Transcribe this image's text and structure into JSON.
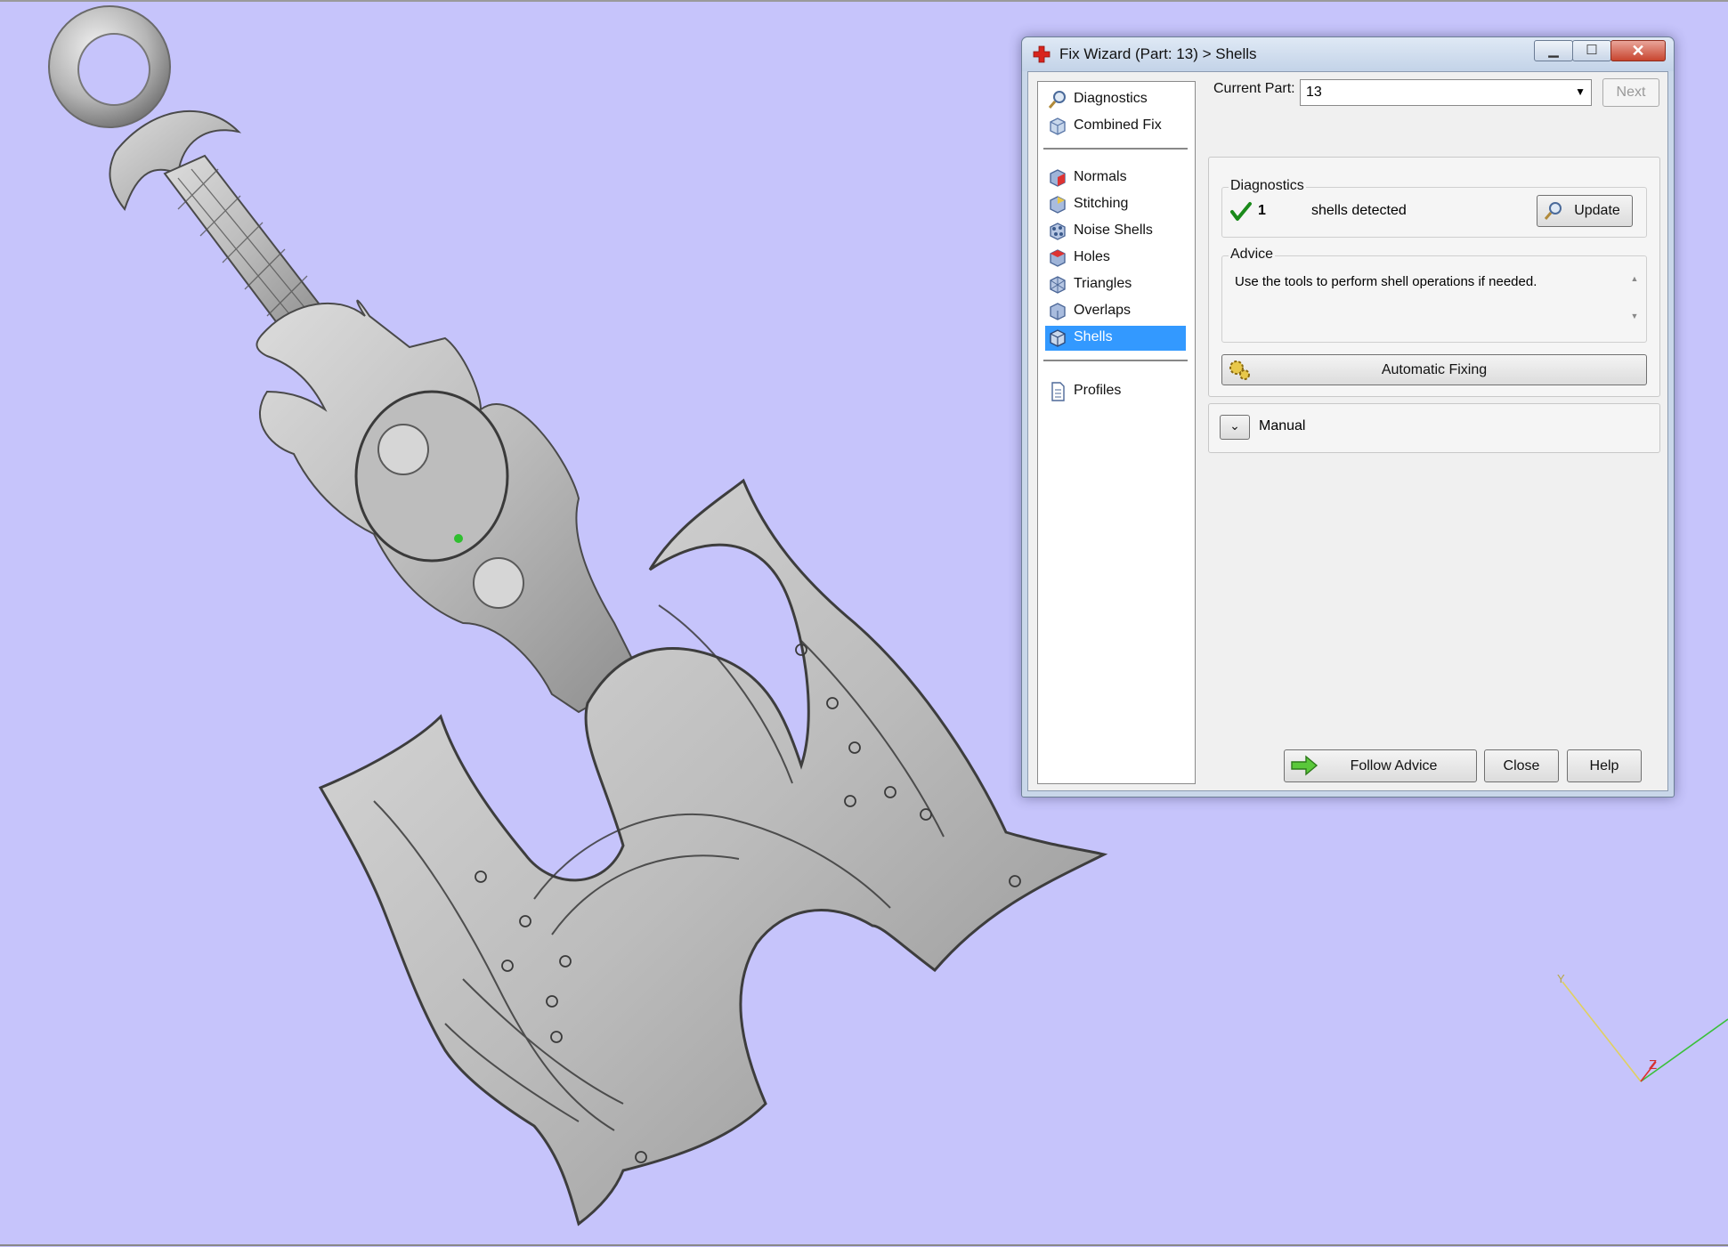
{
  "window": {
    "title": "Fix Wizard (Part: 13) > Shells",
    "minimize_glyph": "▁",
    "maximize_glyph": "☐",
    "close_glyph": "✕"
  },
  "nav": {
    "items": [
      {
        "label": "Diagnostics",
        "icon": "magnifier-icon"
      },
      {
        "label": "Combined Fix",
        "icon": "cube-icon"
      },
      {
        "label": "Normals",
        "icon": "normals-cube-icon"
      },
      {
        "label": "Stitching",
        "icon": "stitching-cube-icon"
      },
      {
        "label": "Noise Shells",
        "icon": "noise-shells-icon"
      },
      {
        "label": "Holes",
        "icon": "holes-cube-icon"
      },
      {
        "label": "Triangles",
        "icon": "triangles-cube-icon"
      },
      {
        "label": "Overlaps",
        "icon": "overlaps-cube-icon"
      },
      {
        "label": "Shells",
        "icon": "shells-cube-icon",
        "selected": true
      },
      {
        "label": "Profiles",
        "icon": "document-icon"
      }
    ]
  },
  "current_part": {
    "label": "Current Part:",
    "value": "13",
    "next_label": "Next"
  },
  "diagnostics": {
    "heading": "Diagnostics",
    "count": "1",
    "text": "shells detected",
    "update_label": "Update"
  },
  "advice": {
    "heading": "Advice",
    "text": "Use the tools to perform shell operations if needed."
  },
  "automatic_fixing_label": "Automatic Fixing",
  "manual_label": "Manual",
  "footer": {
    "follow_advice": "Follow Advice",
    "close": "Close",
    "help": "Help"
  },
  "axis": {
    "y_label": "Y",
    "z_label": "Z"
  },
  "colors": {
    "viewport_bg": "#c6c4fb",
    "selection": "#3399ff",
    "check": "#1a8a1a"
  }
}
